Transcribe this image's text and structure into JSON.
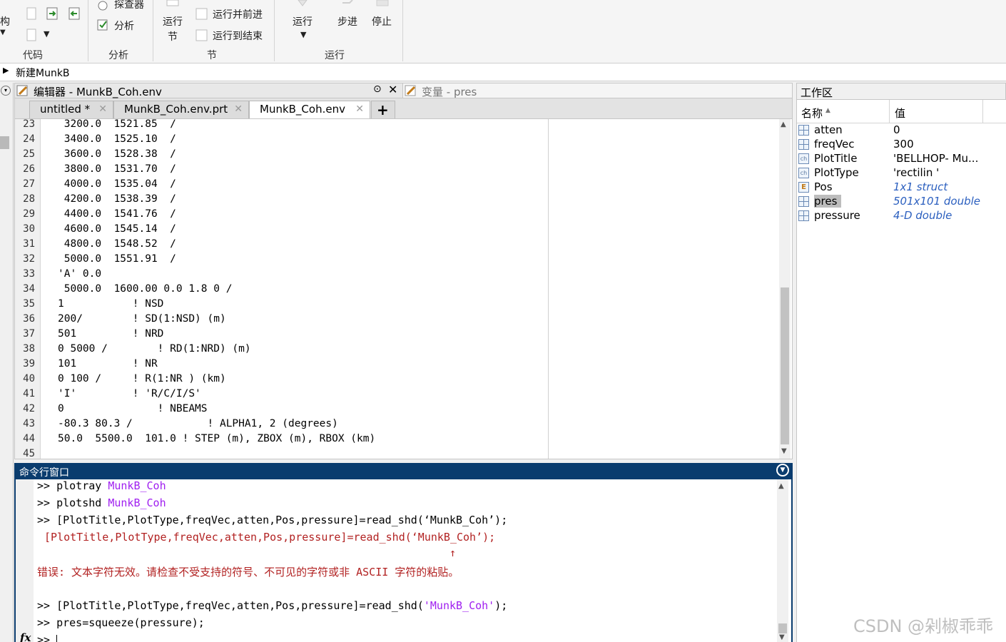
{
  "toolstrip": {
    "code_partial": "构",
    "code_section": "代码",
    "inspector": "探查器",
    "analyze": "分析",
    "analyze_section": "分析",
    "run_section_top": "运行",
    "run_section_bottom": "节",
    "run_and_advance": "运行并前进",
    "run_to_end": "运行到结束",
    "section_section": "节",
    "run": "运行",
    "step": "步进",
    "stop": "停止",
    "run_group": "运行"
  },
  "address": {
    "path": "新建MunkB"
  },
  "editor": {
    "title": "编辑器 - MunkB_Coh.env",
    "variable_title": "变量 - pres",
    "tabs": [
      {
        "label": "untitled *"
      },
      {
        "label": "MunkB_Coh.env.prt"
      },
      {
        "label": "MunkB_Coh.env"
      }
    ],
    "add_tab": "+",
    "lines": [
      {
        "n": "23",
        "text": " 3200.0  1521.85  /"
      },
      {
        "n": "24",
        "text": " 3400.0  1525.10  /"
      },
      {
        "n": "25",
        "text": " 3600.0  1528.38  /"
      },
      {
        "n": "26",
        "text": " 3800.0  1531.70  /"
      },
      {
        "n": "27",
        "text": " 4000.0  1535.04  /"
      },
      {
        "n": "28",
        "text": " 4200.0  1538.39  /"
      },
      {
        "n": "29",
        "text": " 4400.0  1541.76  /"
      },
      {
        "n": "30",
        "text": " 4600.0  1545.14  /"
      },
      {
        "n": "31",
        "text": " 4800.0  1548.52  /"
      },
      {
        "n": "32",
        "text": " 5000.0  1551.91  /"
      },
      {
        "n": "33",
        "text": "'A' 0.0"
      },
      {
        "n": "34",
        "text": " 5000.0  1600.00 0.0 1.8 0 /"
      },
      {
        "n": "35",
        "text": "1           ! NSD"
      },
      {
        "n": "36",
        "text": "200/        ! SD(1:NSD) (m)"
      },
      {
        "n": "37",
        "text": "501         ! NRD"
      },
      {
        "n": "38",
        "text": "0 5000 /        ! RD(1:NRD) (m)"
      },
      {
        "n": "39",
        "text": "101         ! NR"
      },
      {
        "n": "40",
        "text": "0 100 /     ! R(1:NR ) (km)"
      },
      {
        "n": "41",
        "text": "'I'         ! 'R/C/I/S'"
      },
      {
        "n": "42",
        "text": "0               ! NBEAMS"
      },
      {
        "n": "43",
        "text": "-80.3 80.3 /            ! ALPHA1, 2 (degrees)"
      },
      {
        "n": "44",
        "text": "50.0  5500.0  101.0 ! STEP (m), ZBOX (m), RBOX (km)"
      },
      {
        "n": "45",
        "text": ""
      }
    ]
  },
  "workspace": {
    "title": "工作区",
    "col_name": "名称",
    "col_value": "值",
    "vars": [
      {
        "name": "atten",
        "value": "0"
      },
      {
        "name": "freqVec",
        "value": "300"
      },
      {
        "name": "PlotTitle",
        "value": "'BELLHOP- Mu..."
      },
      {
        "name": "PlotType",
        "value": "'rectilin  '"
      },
      {
        "name": "Pos",
        "value": "1x1 struct"
      },
      {
        "name": "pres",
        "value": "501x101 double"
      },
      {
        "name": "pressure",
        "value": "4-D double"
      }
    ]
  },
  "command": {
    "title": "命令行窗口",
    "prompt": ">>",
    "l1_cmd": "plotray ",
    "l1_arg": "MunkB_Coh",
    "l2_cmd": "plotshd ",
    "l2_arg": "MunkB_Coh",
    "l3": "[PlotTitle,PlotType,freqVec,atten,Pos,pressure]=read_shd(‘MunkB_Coh’);",
    "err_echo": "[PlotTitle,PlotType,freqVec,atten,Pos,pressure]=read_shd(‘MunkB_Coh’);",
    "err_caret": "↑",
    "err_msg": "错误: 文本字符无效。请检查不受支持的符号、不可见的字符或非 ASCII 字符的粘贴。",
    "l4_pre": "[PlotTitle,PlotType,freqVec,atten,Pos,pressure]=read_shd(",
    "l4_arg": "'MunkB_Coh'",
    "l4_post": ");",
    "l5": "pres=squeeze(pressure);",
    "fx": "fx"
  },
  "watermark": "CSDN @剁椒乖乖"
}
